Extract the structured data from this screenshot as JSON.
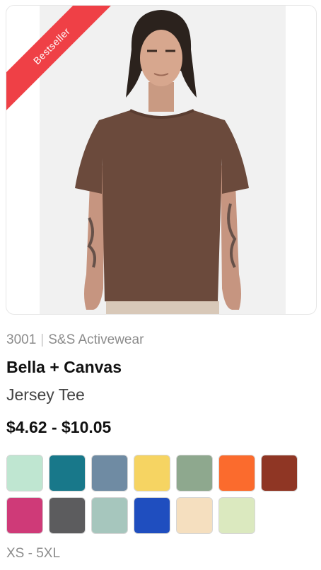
{
  "product": {
    "badge": "Bestseller",
    "style_number": "3001",
    "supplier": "S&S Activewear",
    "brand": "Bella + Canvas",
    "model": "Jersey Tee",
    "price_range": "$4.62 - $10.05",
    "size_range": "XS - 5XL",
    "image": "model-wearing-brown-tee",
    "swatches": [
      {
        "name": "mint-swatch",
        "color": "#bfe6d1"
      },
      {
        "name": "teal-swatch",
        "color": "#18788a"
      },
      {
        "name": "slate-blue-swatch",
        "color": "#6f8ba3"
      },
      {
        "name": "yellow-swatch",
        "color": "#f6d462"
      },
      {
        "name": "sage-swatch",
        "color": "#8ea88e"
      },
      {
        "name": "orange-swatch",
        "color": "#fb6b2d"
      },
      {
        "name": "rust-swatch",
        "color": "#8f3624"
      },
      {
        "name": "berry-swatch",
        "color": "#cf3a78"
      },
      {
        "name": "charcoal-swatch",
        "color": "#5c5c5e"
      },
      {
        "name": "dusty-aqua-swatch",
        "color": "#a6c6bd"
      },
      {
        "name": "royal-blue-swatch",
        "color": "#1f4ebf"
      },
      {
        "name": "natural-swatch",
        "color": "#f5dfbf"
      },
      {
        "name": "light-green-swatch",
        "color": "#dbe9bf"
      }
    ]
  },
  "colors": {
    "badge": "#ef4046",
    "shirt": "#6b4a3c",
    "photo_bg": "#f2f2f2"
  }
}
